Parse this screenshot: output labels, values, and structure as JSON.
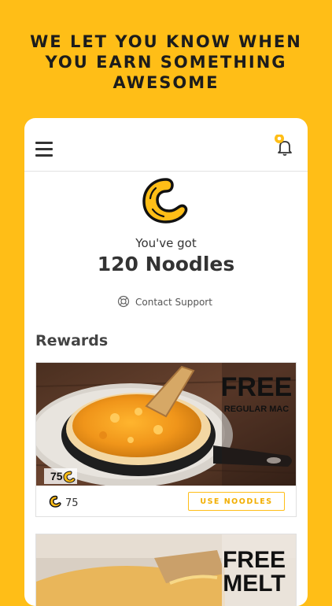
{
  "headline": {
    "line1": "WE LET YOU KNOW WHEN",
    "line2": "YOU EARN SOMETHING",
    "line3": "AWESOME"
  },
  "header": {
    "menu_icon": "hamburger-icon",
    "notification_icon": "bell-icon"
  },
  "balance": {
    "label": "You've got",
    "value": "120 Noodles"
  },
  "support": {
    "icon": "lifebuoy-icon",
    "label": "Contact Support"
  },
  "rewards": {
    "title": "Rewards",
    "items": [
      {
        "title_line1": "FREE",
        "title_line2": "REGULAR MAC",
        "badge_cost": "75",
        "cost": "75",
        "button": "USE NOODLES"
      },
      {
        "title_line1": "FREE",
        "title_line2": "MELT"
      }
    ]
  },
  "colors": {
    "brand_yellow": "#FFBE17",
    "text_dark": "#333333"
  }
}
